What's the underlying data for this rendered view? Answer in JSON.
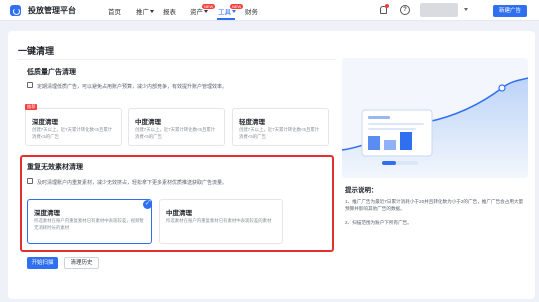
{
  "app": {
    "title": "投放管理平台"
  },
  "nav": {
    "items": [
      {
        "label": "首页",
        "has_caret": false
      },
      {
        "label": "推广",
        "has_caret": true
      },
      {
        "label": "报表",
        "has_caret": false
      },
      {
        "label": "资产",
        "has_caret": true,
        "badge": "NEW"
      },
      {
        "label": "工具",
        "has_caret": true,
        "badge": "NEW",
        "active": true
      },
      {
        "label": "财务",
        "has_caret": false
      }
    ]
  },
  "header": {
    "help_glyph": "?",
    "new_ad_button": "新建广告"
  },
  "page": {
    "title": "一键清理"
  },
  "low_quality": {
    "title": "低质量广告清理",
    "desc": "定期清理低质广告，可以避免占用账户预算，减少内部竞争，有效提升账户管理效率。",
    "cards": [
      {
        "title": "深度清理",
        "tag": "推荐",
        "desc": "创建7天以上，近7天累计转化数<5且累计消费<5的广告"
      },
      {
        "title": "中度清理",
        "desc": "创建7天以上，近7天累计转化数<5且累计消费<5的广告"
      },
      {
        "title": "轻度清理",
        "desc": "创建7天以上，近7天累计转化数<5且累计消费<5的广告"
      }
    ]
  },
  "material": {
    "title": "重复无效素材清理",
    "desc": "及时清理账户内重复素材，减少无效挤占，轻松拿下更多素材优质推送获取广告流量。",
    "cards": [
      {
        "title": "深度清理",
        "desc": "所选素材在账户内重复素材已有素材中表现较差，视频暂无消耗时长的素材",
        "selected": true,
        "check": "✓"
      },
      {
        "title": "中度清理",
        "desc": "所选素材在账户内重复素材已有素材中表现较差的素材",
        "selected": false
      }
    ]
  },
  "actions": {
    "scan": "开始扫描",
    "history": "清理历史"
  },
  "tips": {
    "title": "提示说明：",
    "items": [
      "1、推广广告为最近7日累计消耗小于20并且转化数为小于2的广告，推广广告会占用大量预算并影响其他广告的数据。",
      "2、扫描范围为账户下所有广告。"
    ]
  },
  "colors": {
    "accent": "#2f6ff0",
    "highlight": "#e33131",
    "tag": "#f53f3f"
  }
}
